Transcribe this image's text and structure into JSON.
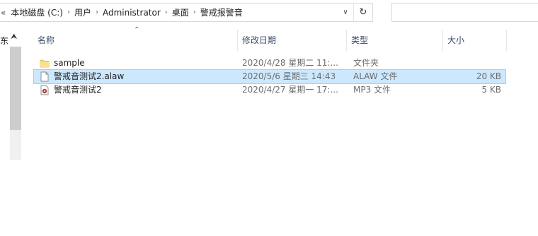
{
  "address": {
    "overflow": "«",
    "crumbs": [
      "本地磁盘 (C:)",
      "用户",
      "Administrator",
      "桌面",
      "警戒报警音"
    ]
  },
  "nav": {
    "label": "东"
  },
  "columns": {
    "name": "名称",
    "date": "修改日期",
    "type": "类型",
    "size": "大小"
  },
  "files": [
    {
      "name": "sample",
      "date": "2020/4/28 星期二 11:...",
      "type": "文件夹",
      "size": "",
      "icon": "folder-icon",
      "selected": false
    },
    {
      "name": "警戒音测试2.alaw",
      "date": "2020/5/6 星期三 14:43",
      "type": "ALAW 文件",
      "size": "20 KB",
      "icon": "file-icon",
      "selected": true
    },
    {
      "name": "警戒音测试2",
      "date": "2020/4/27 星期一 17:...",
      "type": "MP3 文件",
      "size": "5 KB",
      "icon": "mp3-icon",
      "selected": false
    }
  ],
  "colors": {
    "selection": "#cce8ff",
    "selection_border": "#99d1ff",
    "header_text": "#3a4b66",
    "folder": "#f8d775"
  }
}
